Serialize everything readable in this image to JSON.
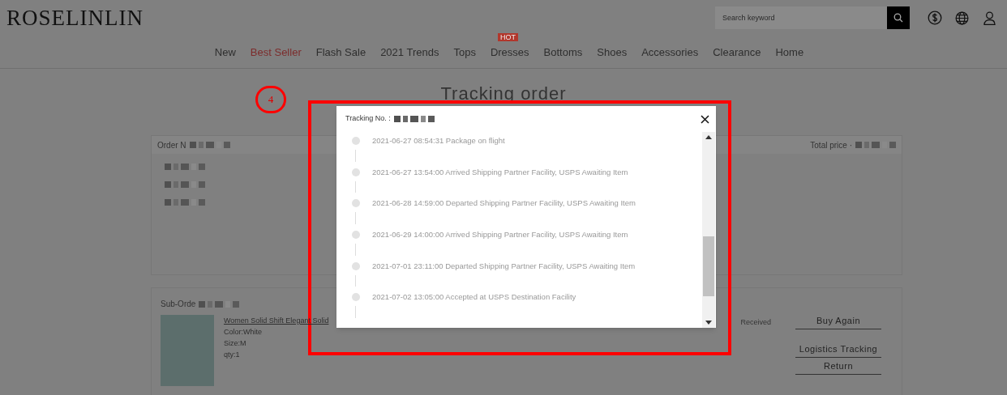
{
  "header": {
    "logo": "ROSELINLIN",
    "search": {
      "placeholder": "Search keyword"
    }
  },
  "nav": [
    {
      "label": "New",
      "selected": false
    },
    {
      "label": "Best Seller",
      "selected": true
    },
    {
      "label": "Flash Sale",
      "selected": false
    },
    {
      "label": "2021 Trends",
      "selected": false
    },
    {
      "label": "Tops",
      "selected": false
    },
    {
      "label": "Dresses",
      "selected": false,
      "badge": "HOT"
    },
    {
      "label": "Bottoms",
      "selected": false
    },
    {
      "label": "Shoes",
      "selected": false
    },
    {
      "label": "Accessories",
      "selected": false
    },
    {
      "label": "Clearance",
      "selected": false
    },
    {
      "label": "Home",
      "selected": false
    }
  ],
  "page_title": "Tracking order",
  "order": {
    "label": "Order N",
    "total_label": "Total price ·"
  },
  "sub_order": {
    "label": "Sub-Orde",
    "product": {
      "title": "Women Solid Shift Elegant Solid",
      "attributes": [
        "Color:White",
        "Size:M",
        "qty:1"
      ]
    },
    "status": "Received",
    "actions": [
      "Buy Again",
      "Logistics Tracking",
      "Return"
    ]
  },
  "annotation": {
    "label": "4"
  },
  "modal": {
    "title": "Tracking No. :",
    "events": [
      {
        "text": "2021-06-27 08:54:31 Package on flight"
      },
      {
        "text": "2021-06-27 13:54:00 Arrived Shipping Partner Facility, USPS Awaiting Item"
      },
      {
        "text": "2021-06-28 14:59:00 Departed Shipping Partner Facility, USPS Awaiting Item"
      },
      {
        "text": "2021-06-29 14:00:00 Arrived Shipping Partner Facility, USPS Awaiting Item"
      },
      {
        "text": "2021-07-01 23:11:00 Departed Shipping Partner Facility, USPS Awaiting Item"
      },
      {
        "text": "2021-07-02 13:05:00 Accepted at USPS Destination Facility"
      }
    ]
  }
}
